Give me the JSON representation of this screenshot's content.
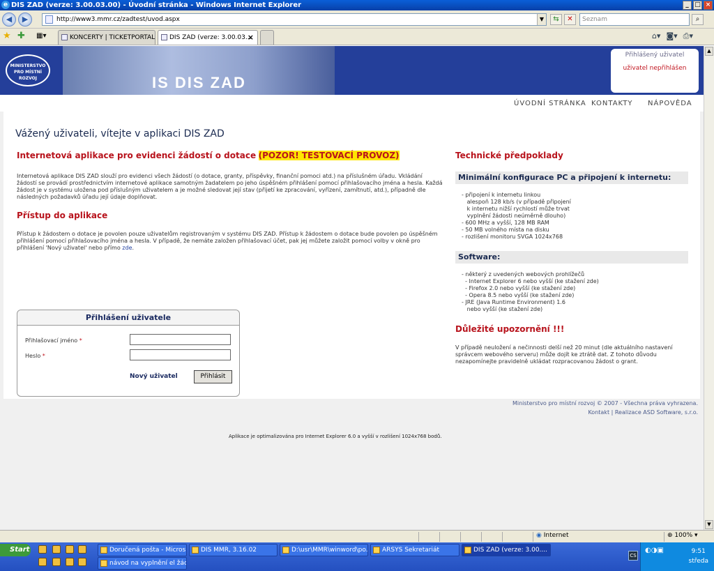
{
  "window": {
    "title": "DIS ZAD (verze: 3.00.03.00) - Úvodní stránka - Windows Internet Explorer"
  },
  "address": {
    "url": "http://www3.mmr.cz/zadtest/uvod.aspx",
    "search_placeholder": "Seznam"
  },
  "tabs": [
    {
      "label": "KONCERTY | TICKETPORTAL..."
    },
    {
      "label": "DIS ZAD (verze: 3.00.03..."
    }
  ],
  "banner": {
    "title": "IS DIS ZAD",
    "logo_text": "MINISTERSTVO PRO MÍSTNÍ ROZVOJ",
    "login_header": "Přihlášený uživatel",
    "login_value": "uživatel nepřihlášen"
  },
  "nav": {
    "home": "ÚVODNÍ STRÁNKA",
    "contacts": "KONTAKTY",
    "help": "NÁPOVĚDA"
  },
  "main": {
    "welcome": "Vážený uživateli, vítejte v aplikaci DIS ZAD",
    "intro_heading": "Internetová aplikace pro evidenci žádostí o dotace",
    "warning": "(POZOR! TESTOVACÍ PROVOZ)",
    "intro_text": "Internetová aplikace DIS ZAD slouží pro evidenci všech žádostí (o dotace, granty, příspěvky, finanční pomoci atd.) na příslušném úřadu. Vkládání žádostí se provádí prostřednictvím internetové aplikace samotným žadatelem po jeho úspěšném přihlášení pomocí přihlašovacího jména a hesla. Každá žádost je v systému uložena pod příslušným uživatelem a je možné sledovat její stav (přijetí ke zpracování, vyřízení, zamítnutí, atd.), případně dle následných požadavků úřadu její údaje doplňovat.",
    "access_heading": "Přístup do aplikace",
    "access_text": "Přístup k žádostem o dotace je povolen pouze uživatelům registrovaným v systému DIS ZAD. Přístup k žádostem o dotace bude povolen po úspěšném přihlášení pomocí přihlašovacího jména a hesla. V případě, že nemáte založen přihlašovací účet, pak jej můžete založit pomocí volby v okně pro přihlášení 'Nový uživatel' nebo přímo",
    "access_link": "zde",
    "login_title": "Přihlášení uživatele",
    "username_label": "Přihlašovací jméno",
    "password_label": "Heslo",
    "required_mark": "*",
    "new_user": "Nový uživatel",
    "login_button": "Přihlásit",
    "optimized_note": "Aplikace je optimalizována pro Internet Explorer 6.0 a vyšší v rozlišení 1024x768 bodů."
  },
  "side": {
    "tech_heading": "Technické předpoklady",
    "min_config_heading": "Minimální konfigurace PC a připojení k internetu:",
    "min_config_list": "- připojení k internetu linkou\n   alespoň 128 kb/s (v případě připojení\n   k internetu nižší rychlostí může trvat\n   vyplnění žádosti neúměrně dlouho)\n- 600 MHz a vyšší, 128 MB RAM\n- 50 MB volného místa na disku\n- rozlišení monitoru SVGA 1024x768",
    "software_heading": "Software:",
    "software_list": "- některý z uvedených webových prohlížečů\n  - Internet Explorer 6 nebo vyšší (ke stažení zde)\n  - Firefox 2.0 nebo vyšší (ke stažení zde)\n  - Opera 8.5 nebo vyšší (ke stažení zde)\n- JRE (Java Runtime Environment) 1.6\n   nebo vyšší (ke stažení zde)",
    "important_heading": "Důležité upozornění !!!",
    "important_text": "V případě neuložení a nečinnosti delší než 20 minut (dle aktuálního nastavení správcem webového serveru) může dojít ke ztrátě dat. Z tohoto důvodu nezapomínejte pravidelně ukládat rozpracovanou žádost o grant."
  },
  "footer": {
    "copyright": "Ministerstvo pro místní rozvoj © 2007 - Všechna práva vyhrazena.",
    "links": "Kontakt | Realizace ASD Software, s.r.o."
  },
  "status": {
    "zone": "Internet",
    "zoom": "100%"
  },
  "taskbar": {
    "start": "Start",
    "tasks": [
      "Doručená pošta - Micros...",
      "DIS MMR, 3.16.02",
      "D:\\usr\\MMR\\winword\\po...",
      "ARSYS Sekretariát",
      "DIS ZAD (verze: 3.00....",
      "návod na vyplnění el žád..."
    ],
    "time": "9:51",
    "day": "středa"
  }
}
